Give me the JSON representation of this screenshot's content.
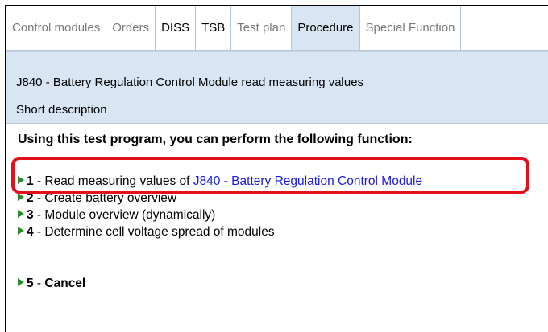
{
  "tabs": [
    {
      "label": "Control modules"
    },
    {
      "label": "Orders"
    },
    {
      "label": "DISS"
    },
    {
      "label": "TSB"
    },
    {
      "label": "Test plan"
    },
    {
      "label": "Procedure"
    },
    {
      "label": "Special Function"
    }
  ],
  "active_tab": "Procedure",
  "header": {
    "title": "J840 - Battery Regulation Control Module  read measuring values",
    "short_description": "Short description"
  },
  "content": {
    "intro": "Using this test program, you can perform the following function:",
    "items": [
      {
        "number": "1",
        "sep": " - ",
        "text": "Read measuring values of ",
        "link": "J840 - Battery Regulation Control Module"
      },
      {
        "number": "2",
        "sep": " - ",
        "text": "Create battery overview"
      },
      {
        "number": "3",
        "sep": " - ",
        "text": "Module overview (dynamically)"
      },
      {
        "number": "4",
        "sep": " - ",
        "text": "Determine cell voltage spread of modules"
      },
      {
        "number": "5",
        "sep": " - ",
        "text": "Cancel"
      }
    ]
  },
  "colors": {
    "header_bg": "#d8e5f2",
    "link": "#1a1adb",
    "arrow": "#2b8a2b",
    "highlight": "#e3101b"
  }
}
